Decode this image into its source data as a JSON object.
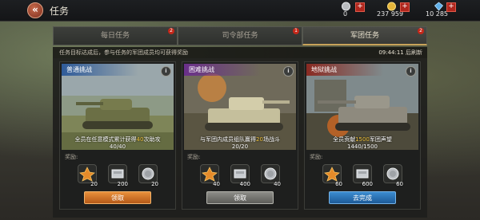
{
  "topbar": {
    "title": "任务",
    "back_icon": "back-arrow-icon",
    "resources": [
      {
        "name": "silver",
        "value": "0",
        "icon": "silver-coin-icon"
      },
      {
        "name": "gold",
        "value": "237 959",
        "icon": "gold-coin-icon"
      },
      {
        "name": "diamond",
        "value": "10 285",
        "icon": "diamond-icon"
      }
    ],
    "plus_label": "+"
  },
  "tabs": [
    {
      "label": "每日任务",
      "badge": "2",
      "active": false
    },
    {
      "label": "司令部任务",
      "badge": "1",
      "active": false
    },
    {
      "label": "军团任务",
      "badge": "2",
      "active": true
    }
  ],
  "info": {
    "description": "任务目标达成后，参与任务的军团成员均可获得奖励",
    "timer": "09:44:11",
    "timer_suffix": "后刷新"
  },
  "cards": [
    {
      "header": "普通挑战",
      "header_color": "#2f5b9a",
      "task_pre": "全员在任意模式累计获得",
      "task_num": "40",
      "task_post": "次助攻",
      "progress": "40/40",
      "reward_label": "奖励:",
      "rewards": [
        "20",
        "200",
        "20"
      ],
      "button": "领取",
      "button_style": "orange"
    },
    {
      "header": "困难挑战",
      "header_color": "#6a2f8a",
      "task_pre": "与军团内成员组队赢得",
      "task_num": "20",
      "task_post": "场战斗",
      "progress": "20/20",
      "reward_label": "奖励:",
      "rewards": [
        "40",
        "400",
        "40"
      ],
      "button": "领取",
      "button_style": "gray"
    },
    {
      "header": "地狱挑战",
      "header_color": "#8a2a22",
      "task_pre": "全员贡献",
      "task_num": "1500",
      "task_post": "军团声望",
      "progress": "1440/1500",
      "reward_label": "奖励:",
      "rewards": [
        "60",
        "600",
        "60"
      ],
      "button": "去完成",
      "button_style": "blue"
    }
  ],
  "info_icon_label": "i"
}
